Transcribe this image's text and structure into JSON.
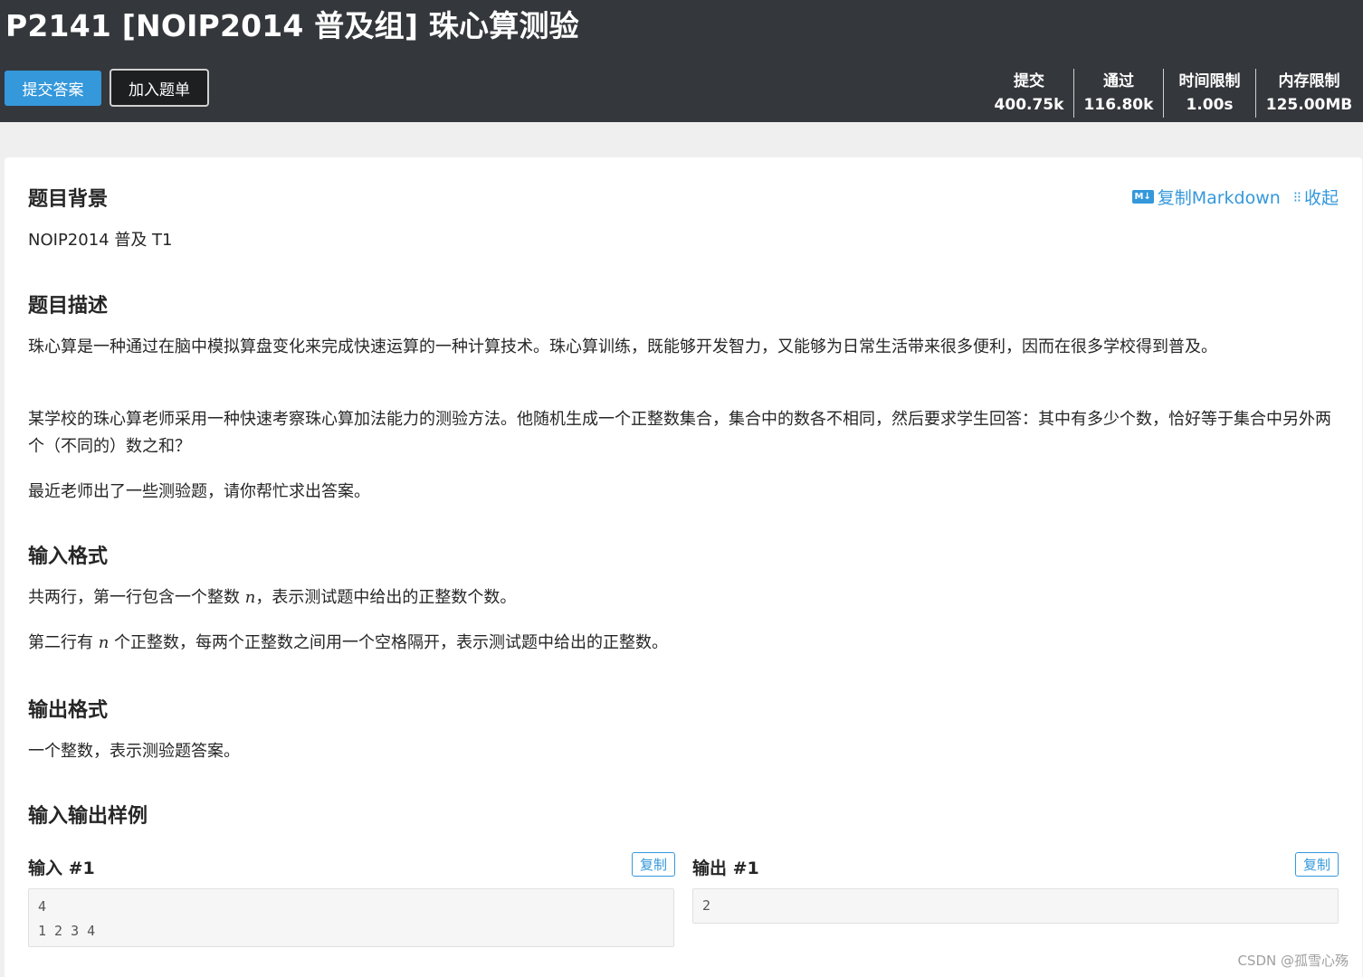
{
  "header": {
    "title": "P2141 [NOIP2014 普及组] 珠心算测验",
    "submit_label": "提交答案",
    "add_list_label": "加入题单",
    "stats": [
      {
        "label": "提交",
        "value": "400.75k"
      },
      {
        "label": "通过",
        "value": "116.80k"
      },
      {
        "label": "时间限制",
        "value": "1.00s"
      },
      {
        "label": "内存限制",
        "value": "125.00MB"
      }
    ]
  },
  "actions": {
    "copy_markdown": "复制Markdown",
    "collapse": "收起",
    "md_icon_text": "M↓"
  },
  "background": {
    "heading": "题目背景",
    "text": "NOIP2014 普及 T1"
  },
  "description": {
    "heading": "题目描述",
    "p1": "珠心算是一种通过在脑中模拟算盘变化来完成快速运算的一种计算技术。珠心算训练，既能够开发智力，又能够为日常生活带来很多便利，因而在很多学校得到普及。",
    "p2": "某学校的珠心算老师采用一种快速考察珠心算加法能力的测验方法。他随机生成一个正整数集合，集合中的数各不相同，然后要求学生回答：其中有多少个数，恰好等于集合中另外两个（不同的）数之和？",
    "p3": "最近老师出了一些测验题，请你帮忙求出答案。"
  },
  "input_format": {
    "heading": "输入格式",
    "p1_before": "共两行，第一行包含一个整数 ",
    "var": "n",
    "p1_after": "，表示测试题中给出的正整数个数。",
    "p2_before": "第二行有 ",
    "p2_after": " 个正整数，每两个正整数之间用一个空格隔开，表示测试题中给出的正整数。"
  },
  "output_format": {
    "heading": "输出格式",
    "text": "一个整数，表示测验题答案。"
  },
  "samples": {
    "heading": "输入输出样例",
    "input_label": "输入 #1",
    "output_label": "输出 #1",
    "copy_label": "复制",
    "input_text": "4\n1 2 3 4",
    "output_text": "2"
  },
  "watermark": "CSDN @孤雪心殇"
}
